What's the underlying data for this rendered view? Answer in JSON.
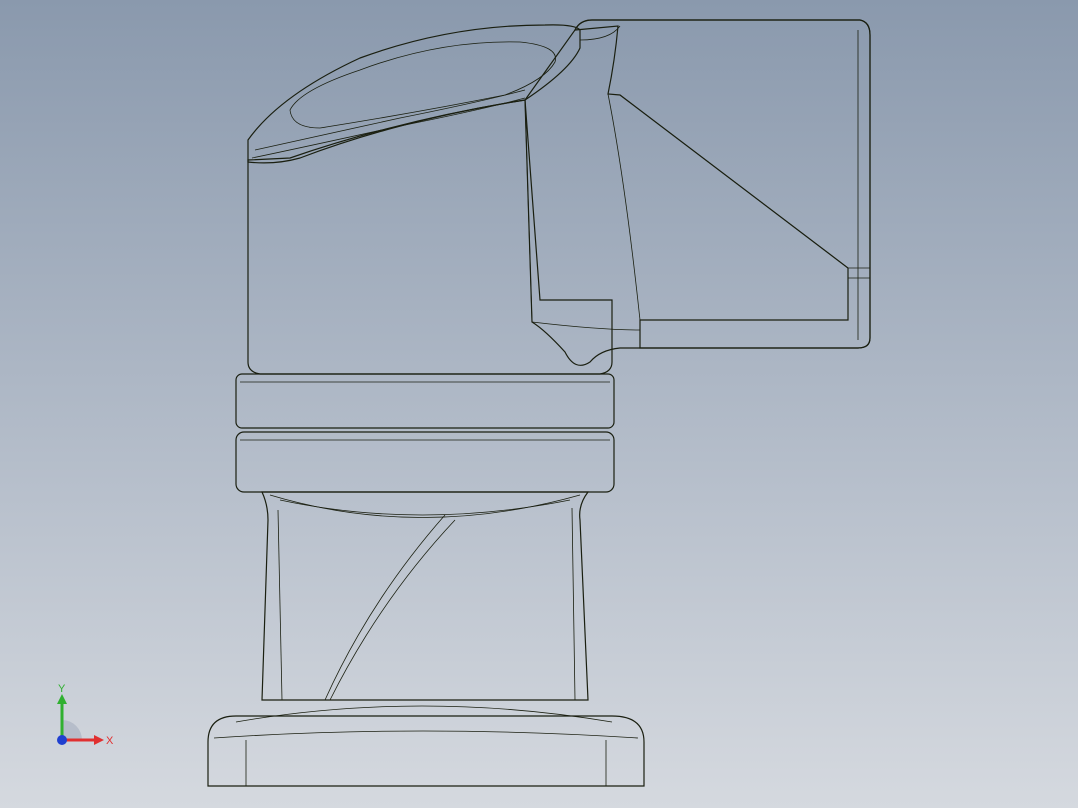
{
  "viewport": {
    "background_top": "#8a99ad",
    "background_bottom": "#d5d9df"
  },
  "model": {
    "part_color": "#b5d82e",
    "shade_color": "#7f9a20",
    "edge_color": "#1a1f10"
  },
  "triad": {
    "x_label": "X",
    "y_label": "Y",
    "x_color": "#e03030",
    "y_color": "#30b030",
    "z_color": "#2040d0"
  }
}
